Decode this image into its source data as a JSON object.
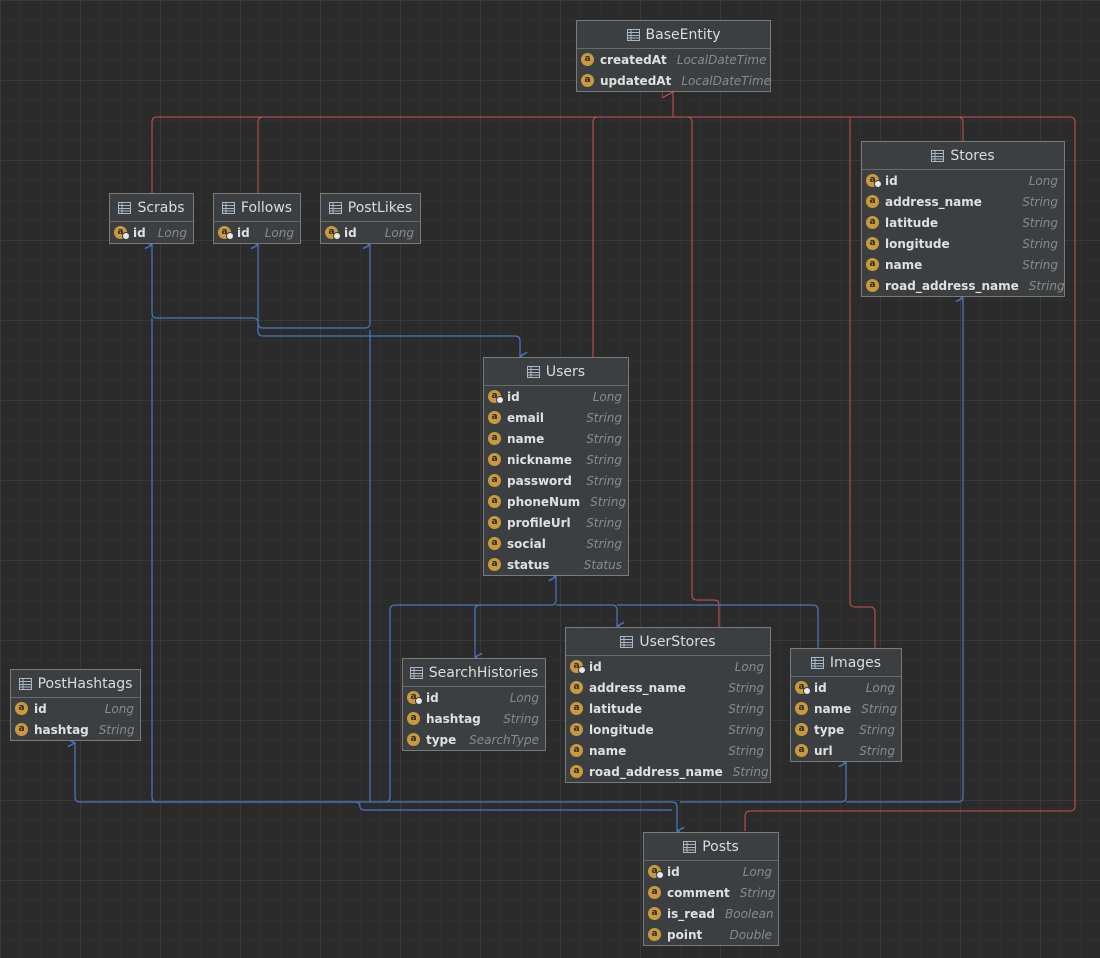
{
  "entities": {
    "BaseEntity": {
      "name": "BaseEntity",
      "fields": [
        {
          "name": "createdAt",
          "type": "LocalDateTime",
          "pk": false
        },
        {
          "name": "updatedAt",
          "type": "LocalDateTime",
          "pk": false
        }
      ]
    },
    "Scrabs": {
      "name": "Scrabs",
      "fields": [
        {
          "name": "id",
          "type": "Long",
          "pk": true
        }
      ]
    },
    "Follows": {
      "name": "Follows",
      "fields": [
        {
          "name": "id",
          "type": "Long",
          "pk": true
        }
      ]
    },
    "PostLikes": {
      "name": "PostLikes",
      "fields": [
        {
          "name": "id",
          "type": "Long",
          "pk": true
        }
      ]
    },
    "Stores": {
      "name": "Stores",
      "fields": [
        {
          "name": "id",
          "type": "Long",
          "pk": true
        },
        {
          "name": "address_name",
          "type": "String",
          "pk": false
        },
        {
          "name": "latitude",
          "type": "String",
          "pk": false
        },
        {
          "name": "longitude",
          "type": "String",
          "pk": false
        },
        {
          "name": "name",
          "type": "String",
          "pk": false
        },
        {
          "name": "road_address_name",
          "type": "String",
          "pk": false
        }
      ]
    },
    "Users": {
      "name": "Users",
      "fields": [
        {
          "name": "id",
          "type": "Long",
          "pk": true
        },
        {
          "name": "email",
          "type": "String",
          "pk": false
        },
        {
          "name": "name",
          "type": "String",
          "pk": false
        },
        {
          "name": "nickname",
          "type": "String",
          "pk": false
        },
        {
          "name": "password",
          "type": "String",
          "pk": false
        },
        {
          "name": "phoneNum",
          "type": "String",
          "pk": false
        },
        {
          "name": "profileUrl",
          "type": "String",
          "pk": false
        },
        {
          "name": "social",
          "type": "String",
          "pk": false
        },
        {
          "name": "status",
          "type": "Status",
          "pk": false
        }
      ]
    },
    "PostHashtags": {
      "name": "PostHashtags",
      "fields": [
        {
          "name": "id",
          "type": "Long",
          "pk": false
        },
        {
          "name": "hashtag",
          "type": "String",
          "pk": false
        }
      ]
    },
    "SearchHistories": {
      "name": "SearchHistories",
      "fields": [
        {
          "name": "id",
          "type": "Long",
          "pk": true
        },
        {
          "name": "hashtag",
          "type": "String",
          "pk": false
        },
        {
          "name": "type",
          "type": "SearchType",
          "pk": false
        }
      ]
    },
    "UserStores": {
      "name": "UserStores",
      "fields": [
        {
          "name": "id",
          "type": "Long",
          "pk": true
        },
        {
          "name": "address_name",
          "type": "String",
          "pk": false
        },
        {
          "name": "latitude",
          "type": "String",
          "pk": false
        },
        {
          "name": "longitude",
          "type": "String",
          "pk": false
        },
        {
          "name": "name",
          "type": "String",
          "pk": false
        },
        {
          "name": "road_address_name",
          "type": "String",
          "pk": false
        }
      ]
    },
    "Images": {
      "name": "Images",
      "fields": [
        {
          "name": "id",
          "type": "Long",
          "pk": true
        },
        {
          "name": "name",
          "type": "String",
          "pk": false
        },
        {
          "name": "type",
          "type": "String",
          "pk": false
        },
        {
          "name": "url",
          "type": "String",
          "pk": false
        }
      ]
    },
    "Posts": {
      "name": "Posts",
      "fields": [
        {
          "name": "id",
          "type": "Long",
          "pk": true
        },
        {
          "name": "comment",
          "type": "String",
          "pk": false
        },
        {
          "name": "is_read",
          "type": "Boolean",
          "pk": false
        },
        {
          "name": "point",
          "type": "Double",
          "pk": false
        }
      ]
    }
  },
  "field_icon_glyph": "a",
  "icons": {
    "table": "table-icon",
    "field": "field-icon",
    "primary_key": "primary-key-icon"
  },
  "colors": {
    "inheritance": "#c75450",
    "association": "#4a78c0",
    "header_text": "#dcdcdc",
    "field_icon": "#c99a3b"
  }
}
